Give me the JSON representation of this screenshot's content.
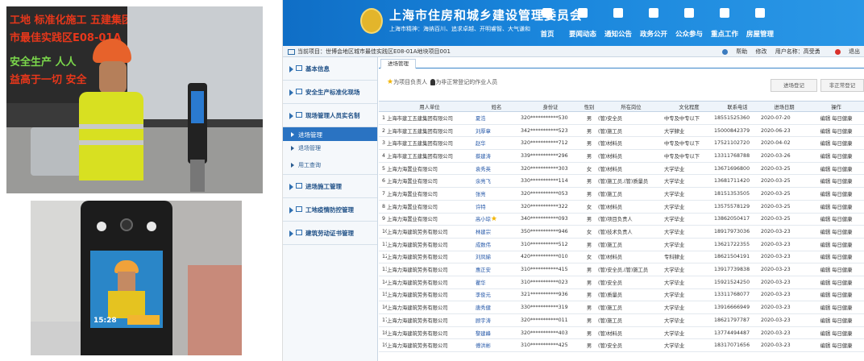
{
  "photo1": {
    "led_lines": [
      {
        "text": "工地 标准化施工  五建集团",
        "color": "red"
      },
      {
        "text": "市最佳实践区E08-01A",
        "color": "red"
      },
      {
        "text": "安全生产  人人",
        "color": "green"
      },
      {
        "text": "益高于一切 安全",
        "color": "red"
      }
    ]
  },
  "photo2": {
    "time": "15:28"
  },
  "app": {
    "title": "上海市住房和城乡建设管理委员会",
    "subtitle": "上海市精神：海纳百川、追求卓越、开明睿智、大气谦和",
    "nav": [
      {
        "label": "首页",
        "icon": "home-icon"
      },
      {
        "label": "要闻动态",
        "icon": "news-icon"
      },
      {
        "label": "通知公告",
        "icon": "notice-icon"
      },
      {
        "label": "政务公开",
        "icon": "chart-icon"
      },
      {
        "label": "公众参与",
        "icon": "gear-icon"
      },
      {
        "label": "重点工作",
        "icon": "building-icon"
      },
      {
        "label": "房屋管理",
        "icon": "house-icon"
      }
    ]
  },
  "infobar": {
    "current_project": "当前项目：世博会地区城市最佳实践区E08-01A地块项目001",
    "help": "帮助",
    "change": "修改",
    "user": "用户名称：高受勇",
    "logout": "退出"
  },
  "sidebar": {
    "sections_top": [
      "基本信息",
      "安全生产标准化现场",
      "现场管理人员实名制"
    ],
    "active": "进场管理",
    "subs": [
      "退场管理",
      "用工查询"
    ],
    "sections_bottom": [
      "进场施工管理",
      "工地疫情防控管理",
      "建筑劳动证书管理"
    ]
  },
  "main": {
    "tab": "进场管理",
    "legend_a": "为项目负责人",
    "legend_b": "为非正常登记的作业人员",
    "btn_in": "进场登记",
    "btn_out": "非正常登记",
    "columns": [
      "",
      "用人单位",
      "姓名",
      "身份证",
      "性别",
      "所在岗位",
      "文化程度",
      "联系电话",
      "进场日期",
      "操作"
    ],
    "action_edit": "编辑",
    "action_health": "每日健康",
    "rows": [
      [
        "1",
        "上海市建工五建集团有限公司",
        "夏浩",
        "320***********530",
        "男",
        "(管)安全员",
        "中专及中专以下",
        "18551525360",
        "2020-07-20"
      ],
      [
        "2",
        "上海市建工五建集团有限公司",
        "刘厚章",
        "342***********523",
        "男",
        "(管)施工员",
        "大学肄业",
        "15000842379",
        "2020-06-23"
      ],
      [
        "3",
        "上海市建工五建集团有限公司",
        "赵华",
        "320***********712",
        "男",
        "(管)材料员",
        "中专及中专以下",
        "17521102720",
        "2020-04-02"
      ],
      [
        "4",
        "上海市建工五建集团有限公司",
        "蔡建涛",
        "339***********296",
        "男",
        "(管)材料员",
        "中专及中专以下",
        "13311768788",
        "2020-03-26"
      ],
      [
        "5",
        "上海力海置业有限公司",
        "袁秀英",
        "320***********303",
        "女",
        "(管)材料员",
        "大学毕业",
        "13671696800",
        "2020-03-25"
      ],
      [
        "6",
        "上海力海置业有限公司",
        "余亮飞",
        "330***********114",
        "男",
        "(管)施工员,(管)质量员",
        "大学毕业",
        "13681711420",
        "2020-03-25"
      ],
      [
        "7",
        "上海力海置业有限公司",
        "张亮",
        "320***********053",
        "男",
        "(管)施工员",
        "大学毕业",
        "18151353505",
        "2020-03-25"
      ],
      [
        "8",
        "上海力海置业有限公司",
        "许特",
        "320***********322",
        "女",
        "(管)材料员",
        "大学毕业",
        "13575578129",
        "2020-03-25"
      ],
      [
        "9",
        "上海力海置业有限公司",
        "高小琼",
        "340***********093",
        "男",
        "(管)项目负责人",
        "大学毕业",
        "13862050417",
        "2020-03-25"
      ],
      [
        "10",
        "上海力海建筑劳务有限公司",
        "林建宗",
        "350***********946",
        "女",
        "(管)技术负责人",
        "大学毕业",
        "18917973036",
        "2020-03-23"
      ],
      [
        "11",
        "上海力海建筑劳务有限公司",
        "成数伟",
        "310***********512",
        "男",
        "(管)施工员",
        "大学毕业",
        "13621722355",
        "2020-03-23"
      ],
      [
        "12",
        "上海力海建筑劳务有限公司",
        "刘凤娣",
        "420***********010",
        "女",
        "(管)材料员",
        "专科肄业",
        "18621504191",
        "2020-03-23"
      ],
      [
        "13",
        "上海力海建筑劳务有限公司",
        "惠正安",
        "310***********415",
        "男",
        "(管)安全员,(管)施工员",
        "大学毕业",
        "13917739838",
        "2020-03-23"
      ],
      [
        "14",
        "上海力海建筑劳务有限公司",
        "瞿华",
        "310***********023",
        "男",
        "(管)安全员",
        "大学毕业",
        "15921524250",
        "2020-03-23"
      ],
      [
        "15",
        "上海力海建筑劳务有限公司",
        "李俊元",
        "321***********936",
        "男",
        "(管)质量员",
        "大学毕业",
        "13311768077",
        "2020-03-23"
      ],
      [
        "16",
        "上海力海建筑劳务有限公司",
        "唐秀健",
        "330***********319",
        "男",
        "(管)施工员",
        "大学毕业",
        "13916666949",
        "2020-03-23"
      ],
      [
        "17",
        "上海力海建筑劳务有限公司",
        "顾宇涛",
        "320***********011",
        "男",
        "(管)施工员",
        "大学毕业",
        "18621797787",
        "2020-03-23"
      ],
      [
        "18",
        "上海力海建筑劳务有限公司",
        "黎建峰",
        "320***********403",
        "男",
        "(管)材料员",
        "大学毕业",
        "13774494487",
        "2020-03-23"
      ],
      [
        "19",
        "上海力海建筑劳务有限公司",
        "傅洪彬",
        "310***********425",
        "男",
        "(管)安全员",
        "大学毕业",
        "18317071656",
        "2020-03-23"
      ]
    ]
  }
}
